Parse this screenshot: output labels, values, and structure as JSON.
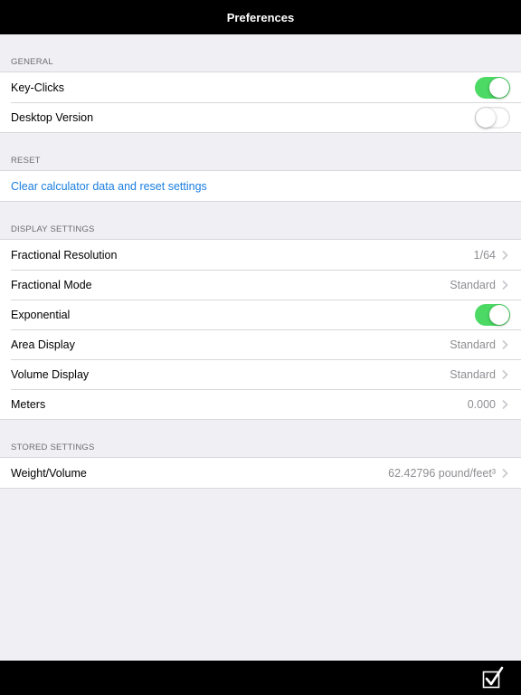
{
  "navbar": {
    "title": "Preferences"
  },
  "general": {
    "header": "GENERAL",
    "key_clicks": {
      "label": "Key-Clicks",
      "on": true
    },
    "desktop_version": {
      "label": "Desktop Version",
      "on": false
    }
  },
  "reset": {
    "header": "RESET",
    "clear_label": "Clear calculator data and reset settings"
  },
  "display": {
    "header": "DISPLAY SETTINGS",
    "fractional_resolution": {
      "label": "Fractional Resolution",
      "value": "1/64"
    },
    "fractional_mode": {
      "label": "Fractional Mode",
      "value": "Standard"
    },
    "exponential": {
      "label": "Exponential",
      "on": true
    },
    "area_display": {
      "label": "Area Display",
      "value": "Standard"
    },
    "volume_display": {
      "label": "Volume Display",
      "value": "Standard"
    },
    "meters": {
      "label": "Meters",
      "value": "0.000"
    }
  },
  "stored": {
    "header": "STORED SETTINGS",
    "weight_volume": {
      "label": "Weight/Volume",
      "value": "62.42796 pound/feet³"
    }
  },
  "colors": {
    "accent": "#1a7ee0",
    "toggle_on": "#4cd964",
    "bar": "#000000",
    "background": "#efeff4"
  },
  "icons": {
    "chevron": "chevron-right-icon",
    "done": "checkbox-checked-icon"
  }
}
